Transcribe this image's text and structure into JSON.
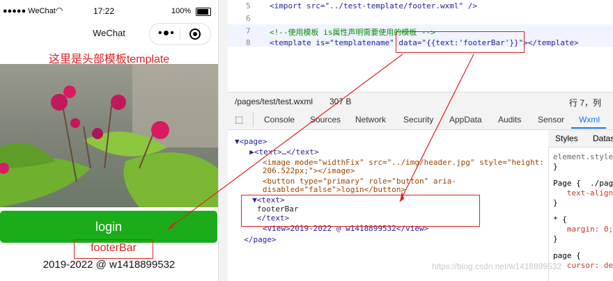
{
  "phone": {
    "status_left": "●●●●● WeChat",
    "status_time": "17:22",
    "status_battery": "100%",
    "nav_title": "WeChat",
    "header_text": "这里是头部模板template",
    "login_label": "login",
    "footer_text": "footerBar",
    "copyright": "2019-2022 @ w1418899532"
  },
  "editor": {
    "lines": [
      {
        "num": "5",
        "code": "<import src=\"../test-template/footer.wxml\" />"
      },
      {
        "num": "6",
        "code": ""
      },
      {
        "num": "7",
        "code": "<!--使用模板 is属性声明需要使用的模板 -->"
      },
      {
        "num": "8",
        "code": "<template is=\"templatename\" data=\"{{text:'footerBar'}}\"></template>"
      }
    ]
  },
  "filebar": {
    "path": "/pages/test/test.wxml",
    "size": "307 B",
    "position": "行 7，列"
  },
  "devtools": {
    "tabs": [
      "Console",
      "Sources",
      "Network",
      "Security",
      "AppData",
      "Audits",
      "Sensor",
      "Wxml"
    ],
    "active_tab": "Wxml",
    "elements": [
      "▼<page>",
      "  ▶<text>…</text>",
      "   <image mode=\"widthFix\" src=\"../img/header.jpg\" style=\"height:",
      "   206.522px;\"></image>",
      "   <button type=\"primary\" role=\"button\" aria-",
      "   disabled=\"false\">login</button>",
      "  ▼<text>",
      "   footerBar",
      "   </text>",
      "   <view>2019-2022 @ w1418899532</view>",
      "  </page>"
    ],
    "styles_tabs": [
      "Styles",
      "Datas"
    ],
    "styles_lines": [
      "element.style {",
      "}",
      "Page {  ./page",
      "   text-align",
      "}",
      "* {",
      "   margin: 0;",
      "}",
      "page {",
      "   cursor: de"
    ]
  },
  "watermark": "https://blog.csdn.net/w1418899532",
  "colors": {
    "accent_red": "#e02020",
    "wechat_green": "#1aad19"
  }
}
